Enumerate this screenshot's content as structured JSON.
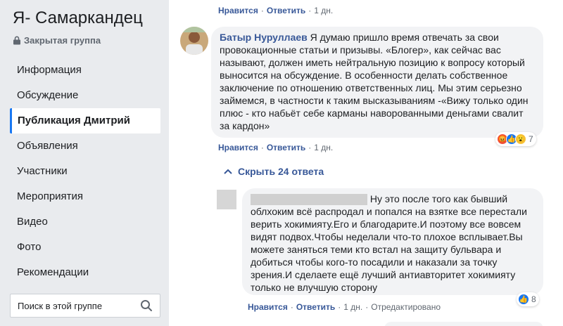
{
  "group": {
    "title": "Я- Самаркандец",
    "subtitle": "Закрытая группа",
    "lock_icon": "lock-icon"
  },
  "sidebar": {
    "items": [
      {
        "label": "Информация"
      },
      {
        "label": "Обсуждение"
      },
      {
        "label": "Публикация Дмитрий"
      },
      {
        "label": "Объявления"
      },
      {
        "label": "Участники"
      },
      {
        "label": "Мероприятия"
      },
      {
        "label": "Видео"
      },
      {
        "label": "Фото"
      },
      {
        "label": "Рекомендации"
      }
    ],
    "active_item": "Публикация Дмитрий",
    "search_placeholder": "Поиск в этой группе"
  },
  "top_actions": {
    "like": "Нравится",
    "reply": "Ответить",
    "time": "1 дн.",
    "separator": "·"
  },
  "comment1": {
    "author": "Батыр Нуруллаев",
    "text": "Я думаю пришло время отвечать за свои провокационные статьи и призывы. «Блогер», как сейчас вас называют, должен иметь нейтральную позицию к вопросу который выносится на обсуждение. В особенности делать собственное заключение по отношению ответственных лиц. Мы этим серьезно займемся, в частности к таким высказываниям -«Вижу только один плюс - кто набьёт себе карманы наворованными деньгами свалит за кардон»",
    "reaction_count": "7",
    "like": "Нравится",
    "reply": "Ответить",
    "time": "1 дн."
  },
  "hide_replies": "Скрыть 24 ответа",
  "comment2": {
    "text": "Ну это после того как бывший облхоким всё распродал и попался на взятке все перестали верить хокимияту.Его и благодарите.И поэтому все вовсем видят подвох.Чтобы неделали что-то плохое всплывает.Вы можете заняться теми кто встал на защиту бульвара и добиться чтобы кого-то посадили и наказали за точку зрения.И сделаете ещё лучший антиавторитет хокимияту только не влучшую сторону",
    "reaction_count": "8",
    "like": "Нравится",
    "reply": "Ответить",
    "time": "1 дн.",
    "edited": "Отредактировано"
  },
  "colors": {
    "link": "#385898",
    "bubble": "#f2f3f5",
    "sidebar_bg": "#e9ebee",
    "accent": "#1877f2"
  }
}
